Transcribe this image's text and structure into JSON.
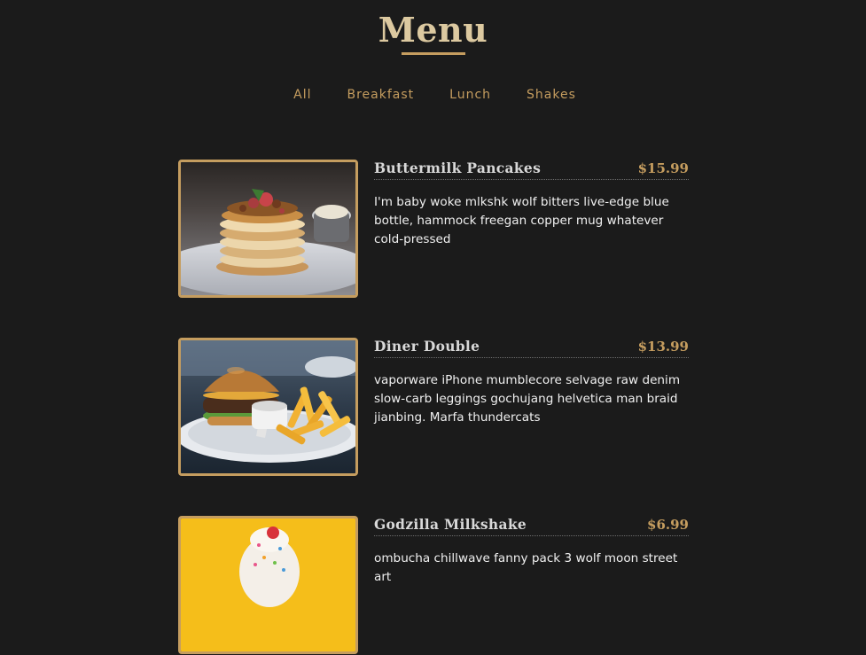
{
  "page": {
    "title": "Menu"
  },
  "filters": [
    {
      "label": "All"
    },
    {
      "label": "Breakfast"
    },
    {
      "label": "Lunch"
    },
    {
      "label": "Shakes"
    }
  ],
  "items": [
    {
      "name": "Buttermilk Pancakes",
      "price": "$15.99",
      "description": "I'm baby woke mlkshk wolf bitters live-edge blue bottle, hammock freegan copper mug whatever cold-pressed",
      "image": "pancakes-photo"
    },
    {
      "name": "Diner Double",
      "price": "$13.99",
      "description": "vaporware iPhone mumblecore selvage raw denim slow-carb leggings gochujang helvetica man braid jianbing. Marfa thundercats",
      "image": "burger-photo"
    },
    {
      "name": "Godzilla Milkshake",
      "price": "$6.99",
      "description": "ombucha chillwave fanny pack 3 wolf moon street art",
      "image": "milkshake-photo"
    }
  ],
  "colors": {
    "background": "#1b1b1b",
    "accent": "#c59d5f",
    "title": "#dcc9a0",
    "text": "#f0f0f0"
  }
}
